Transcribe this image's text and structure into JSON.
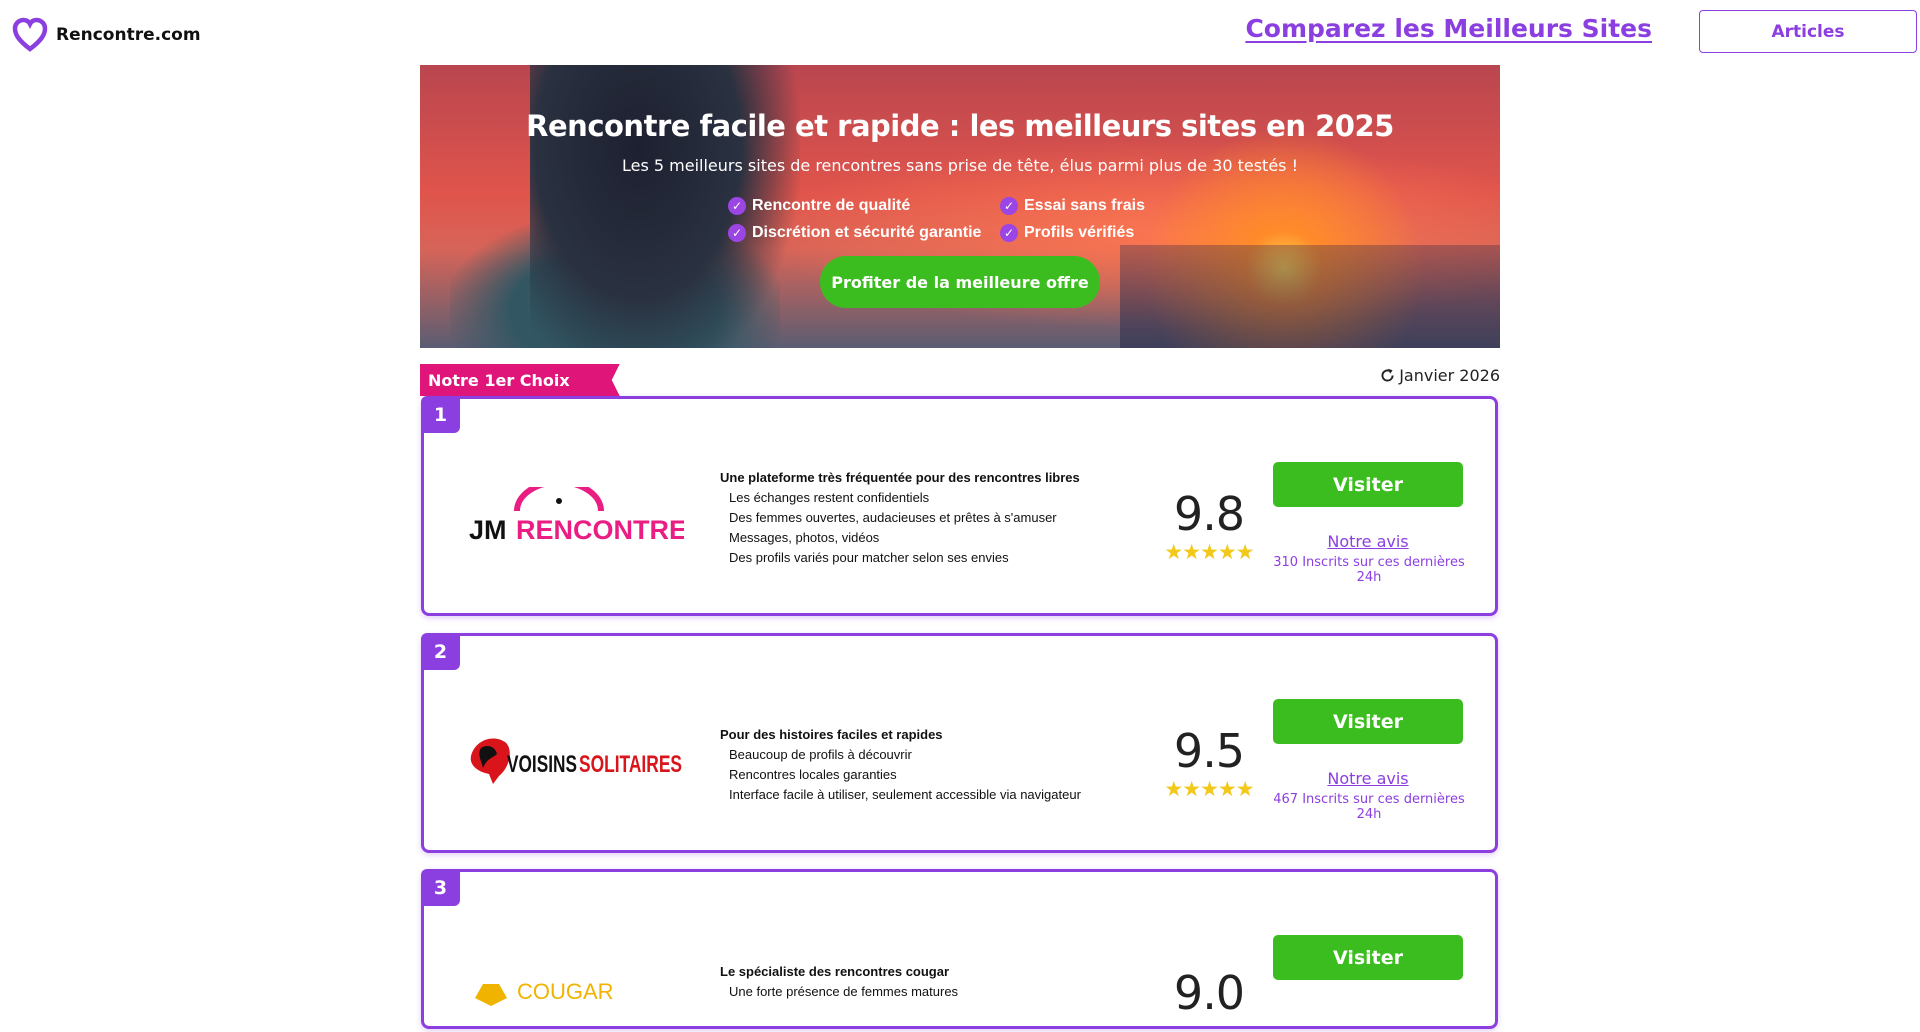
{
  "header": {
    "logo_text": "Rencontre.com",
    "compare_link": "Comparez les Meilleurs Sites",
    "articles_button": "Articles"
  },
  "hero": {
    "title": "Rencontre facile et rapide : les meilleurs sites en 2025",
    "subtitle": "Les 5 meilleurs sites de rencontres sans prise de tête, élus parmi plus de 30 testés !",
    "features": [
      "Rencontre de qualité",
      "Essai sans frais",
      "Discrétion et sécurité garantie",
      "Profils vérifiés"
    ],
    "cta": "Profiter de la meilleure offre"
  },
  "ranking": {
    "ribbon": "Notre 1er Choix",
    "date": "Janvier 2026"
  },
  "sites": [
    {
      "rank": "1",
      "logo_text_a": "JM",
      "logo_text_b": "RENCONTRE",
      "title": "Une plateforme très fréquentée pour des rencontres libres",
      "items": [
        "Les échanges restent confidentiels",
        "Des femmes ouvertes, audacieuses et prêtes à s'amuser",
        "Messages, photos, vidéos",
        "Des profils variés pour matcher selon ses envies"
      ],
      "score": "9.8",
      "stars": "★★★★★",
      "visit": "Visiter",
      "review": "Notre avis",
      "signups": " 310 Inscrits sur ces dernières 24h"
    },
    {
      "rank": "2",
      "logo_text_a": "VOISINS",
      "logo_text_b": "SOLITAIRES",
      "title": "Pour des histoires faciles et rapides",
      "items": [
        " Beaucoup de profils à découvrir",
        " Rencontres locales garanties",
        " Interface facile à utiliser, seulement accessible via navigateur"
      ],
      "score": "9.5",
      "stars": "★★★★★",
      "visit": "Visiter",
      "review": "Notre avis",
      "signups": " 467 Inscrits sur ces dernières 24h"
    },
    {
      "rank": "3",
      "logo_text_a": "COUGAR",
      "title": "Le spécialiste des rencontres cougar",
      "items": [
        " Une forte présence de femmes matures"
      ],
      "score": "9.0",
      "visit": "Visiter"
    }
  ],
  "colors": {
    "accent": "#8c3fe0",
    "cta_green": "#3cbd1f",
    "ribbon_pink": "#e0157a",
    "star_yellow": "#f2c81b"
  }
}
